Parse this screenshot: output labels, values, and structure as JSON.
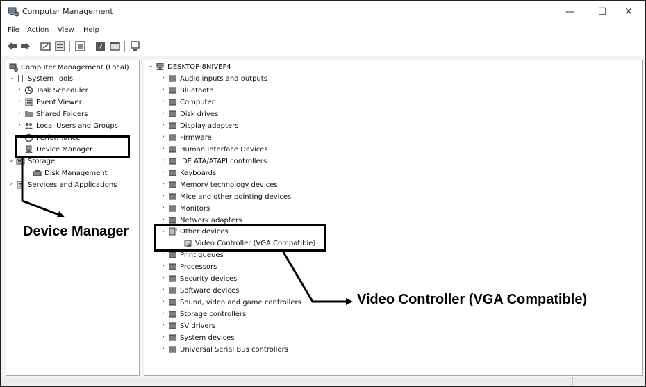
{
  "window": {
    "title": "Computer Management",
    "controls": {
      "minimize": "—",
      "maximize": "☐",
      "close": "✕"
    }
  },
  "menu": [
    {
      "accel": "F",
      "rest": "ile"
    },
    {
      "accel": "A",
      "rest": "ction"
    },
    {
      "accel": "V",
      "rest": "iew"
    },
    {
      "accel": "H",
      "rest": "elp"
    }
  ],
  "toolbar": {
    "buttons": [
      "back-icon",
      "forward-icon",
      "up-folder-icon",
      "properties-icon",
      "export-list-icon",
      "help-icon",
      "console-icon",
      "device-icon"
    ]
  },
  "left_tree": {
    "root": "Computer Management (Local)",
    "system_tools": "System Tools",
    "task_scheduler": "Task Scheduler",
    "event_viewer": "Event Viewer",
    "shared_folders": "Shared Folders",
    "local_users": "Local Users and Groups",
    "performance": "Performance",
    "device_manager": "Device Manager",
    "storage": "Storage",
    "disk_management": "Disk Management",
    "services": "Services and Applications"
  },
  "right_tree": {
    "root": "DESKTOP-8NIVEF4",
    "categories": [
      "Audio inputs and outputs",
      "Bluetooth",
      "Computer",
      "Disk drives",
      "Display adapters",
      "Firmware",
      "Human Interface Devices",
      "IDE ATA/ATAPI controllers",
      "Keyboards",
      "Memory technology devices",
      "Mice and other pointing devices",
      "Monitors",
      "Network adapters"
    ],
    "other_devices": "Other devices",
    "video_controller": "Video Controller (VGA Compatible)",
    "categories_after": [
      "Print queues",
      "Processors",
      "Security devices",
      "Software devices",
      "Sound, video and game controllers",
      "Storage controllers",
      "SV drivers",
      "System devices",
      "Universal Serial Bus controllers"
    ]
  },
  "annotations": {
    "device_manager_label": "Device Manager",
    "video_controller_label": "Video Controller (VGA Compatible)"
  }
}
